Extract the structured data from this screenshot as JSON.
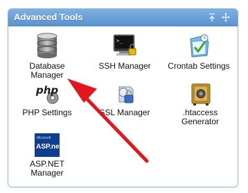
{
  "panel": {
    "title": "Advanced Tools"
  },
  "tools": [
    {
      "label": "Database\nManager",
      "icon": "database-icon"
    },
    {
      "label": "SSH Manager",
      "icon": "terminal-icon"
    },
    {
      "label": "Crontab Settings",
      "icon": "crontab-icon"
    },
    {
      "label": "PHP Settings",
      "icon": "php-icon"
    },
    {
      "label": "SSL Manager",
      "icon": "ssl-lock-icon"
    },
    {
      "label": ".htaccess\nGenerator",
      "icon": "safe-icon"
    },
    {
      "label": "ASP.NET\nManager",
      "icon": "aspnet-icon"
    }
  ],
  "icon_texts": {
    "php": "php",
    "aspnet_brand": "ASP.net",
    "aspnet_small": "Microsoft"
  },
  "colors": {
    "header_top": "#7fb0e2",
    "header_bottom": "#5b93cf",
    "arrow": "#e3161b"
  }
}
